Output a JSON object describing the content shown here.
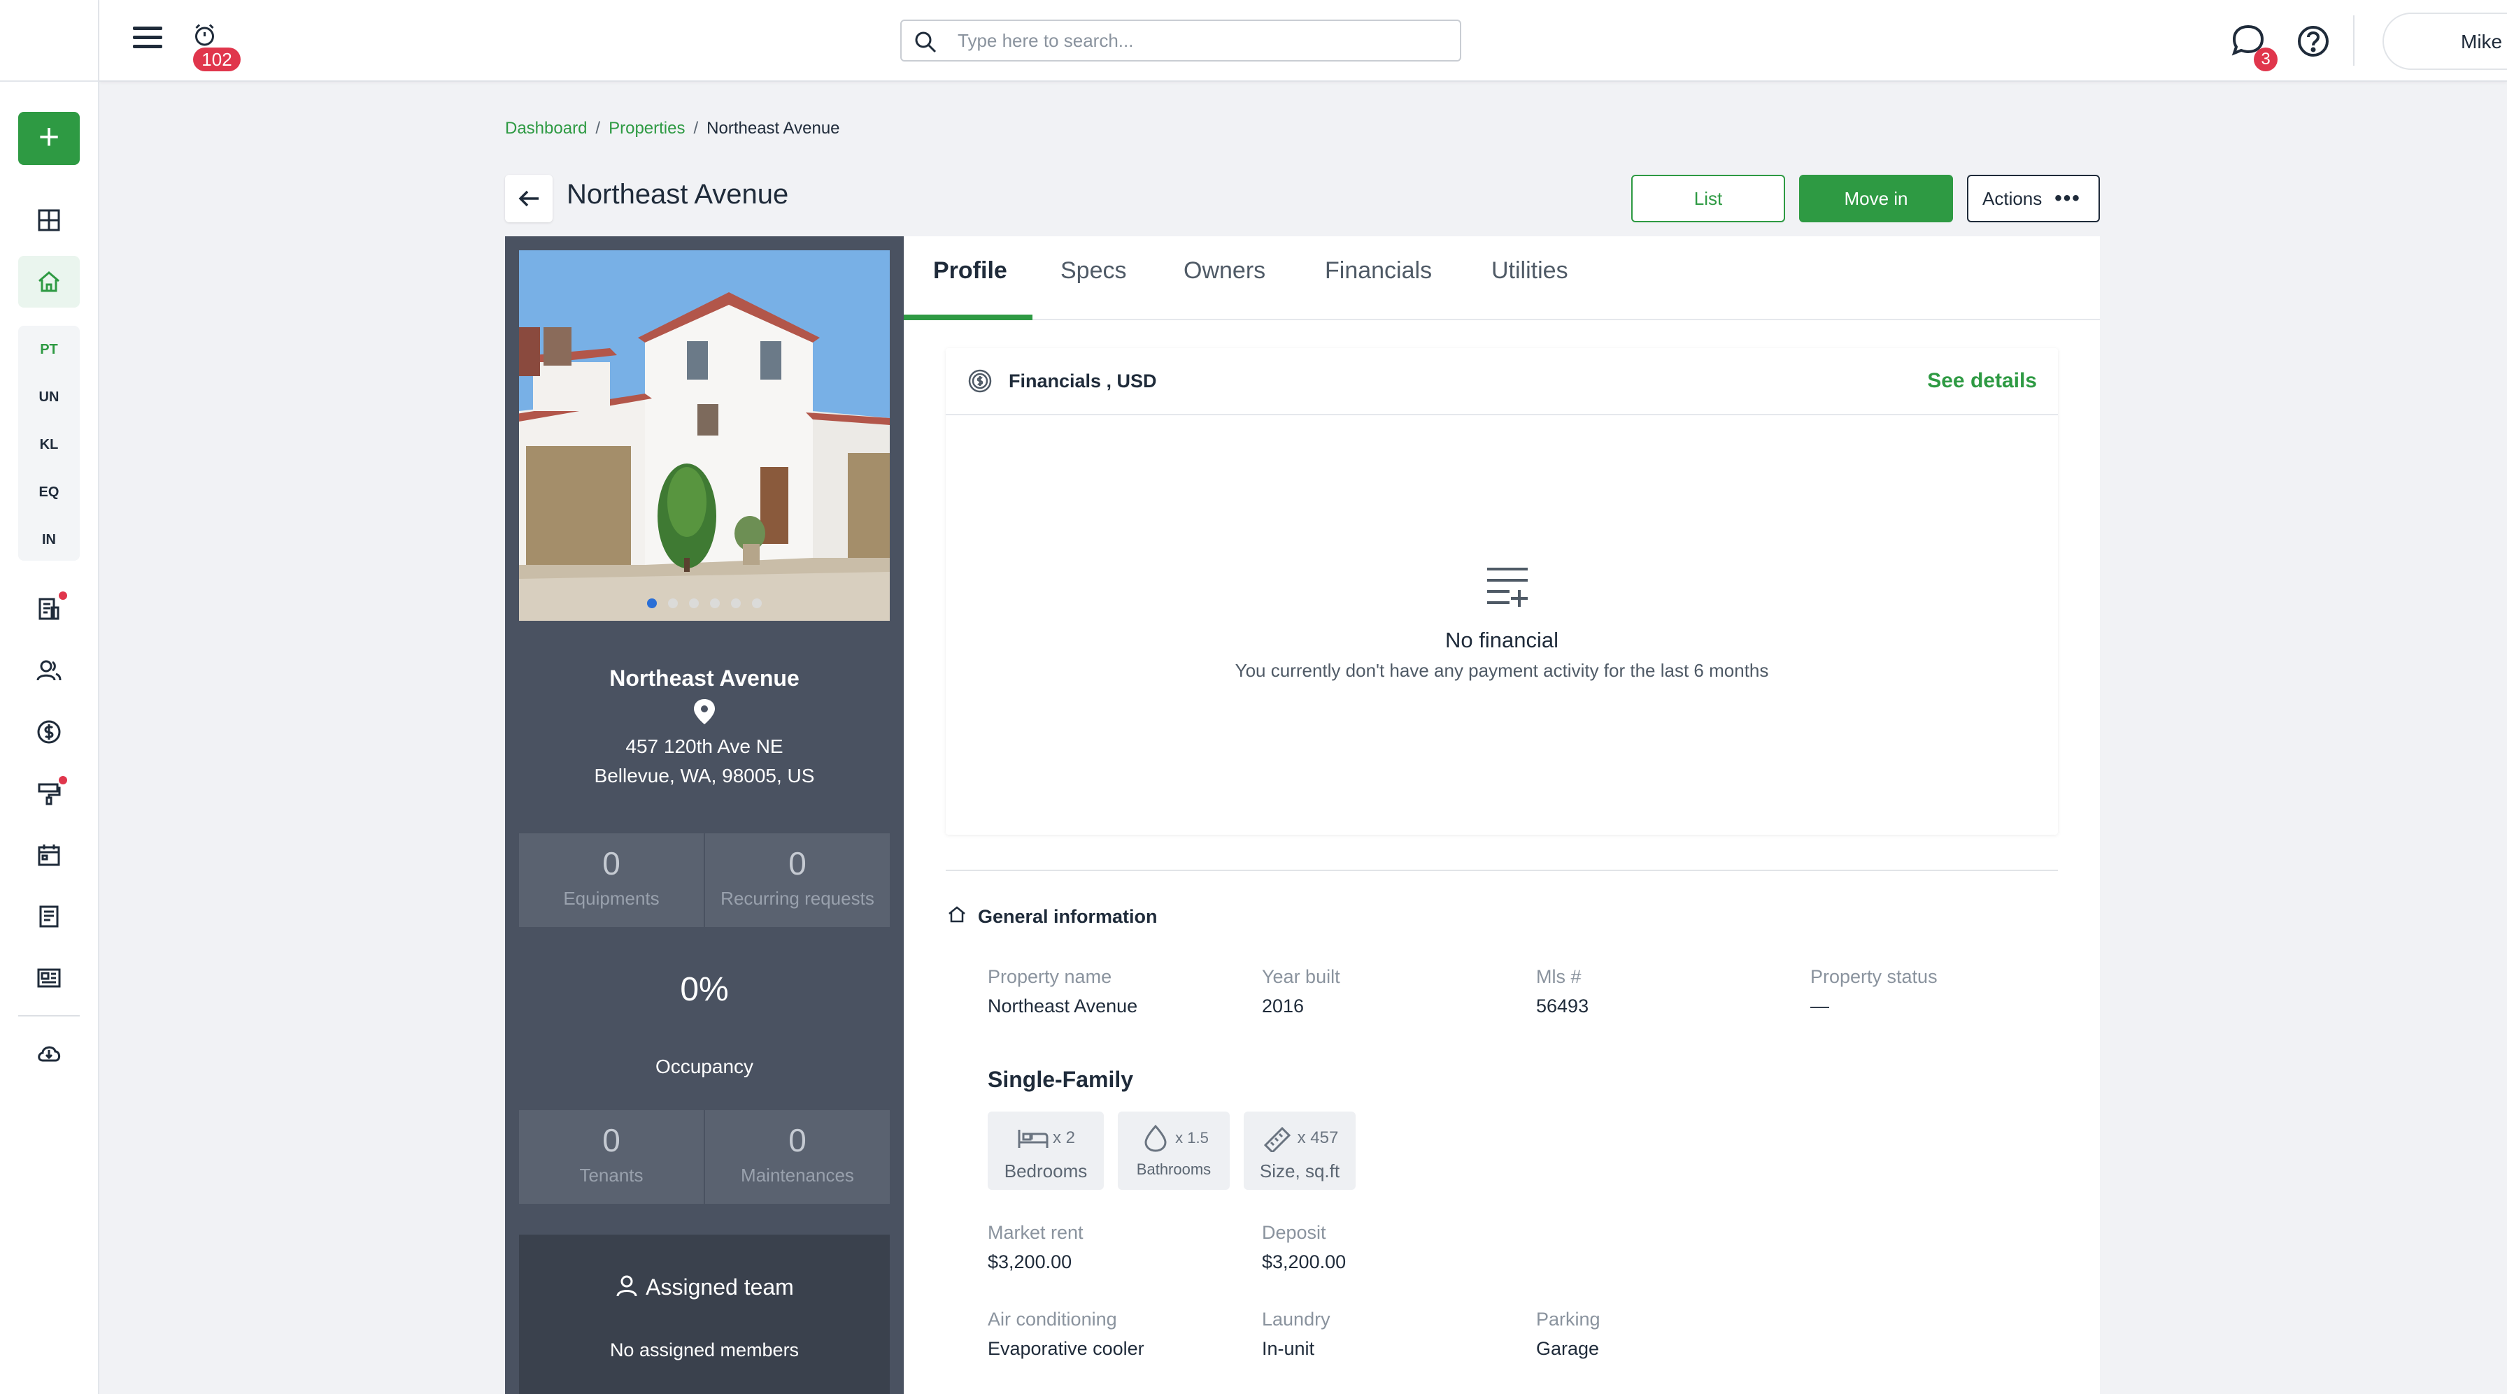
{
  "topbar": {
    "alarm_badge": "102",
    "search_placeholder": "Type here to search...",
    "chat_badge": "3",
    "user_name": "Mike"
  },
  "sidebar": {
    "add_label": "+",
    "sub_items": [
      "PT",
      "UN",
      "KL",
      "EQ",
      "IN"
    ]
  },
  "breadcrumb": {
    "items": [
      "Dashboard",
      "Properties"
    ],
    "current": "Northeast Avenue",
    "separator": "/"
  },
  "header": {
    "title": "Northeast Avenue",
    "list_label": "List",
    "move_in_label": "Move in",
    "actions_label": "Actions",
    "actions_dots": "•••"
  },
  "property": {
    "name": "Northeast Avenue",
    "address_line1": "457 120th Ave NE",
    "address_line2": "Bellevue, WA, 98005, US",
    "photo_count": 6,
    "photo_index": 0,
    "equipments": "0",
    "equipments_label": "Equipments",
    "recurring": "0",
    "recurring_label": "Recurring requests",
    "occupancy": "0%",
    "occupancy_label": "Occupancy",
    "tenants": "0",
    "tenants_label": "Tenants",
    "maintenances": "0",
    "maintenances_label": "Maintenances",
    "team_title": "Assigned team",
    "team_empty": "No assigned members"
  },
  "tabs": [
    "Profile",
    "Specs",
    "Owners",
    "Financials",
    "Utilities"
  ],
  "financials": {
    "title": "Financials , USD",
    "link": "See details",
    "empty_title": "No financial",
    "empty_sub": "You currently don't have any payment activity for the last 6 months"
  },
  "general": {
    "title": "General information",
    "property_name_label": "Property name",
    "property_name": "Northeast Avenue",
    "year_built_label": "Year built",
    "year_built": "2016",
    "mls_label": "Mls #",
    "mls": "56493",
    "status_label": "Property status",
    "status": "—",
    "type": "Single-Family",
    "bedrooms_count": "x 2",
    "bedrooms_label": "Bedrooms",
    "bathrooms_count": "x 1.5",
    "bathrooms_label": "Bathrooms",
    "size_count": "x 457",
    "size_label": "Size, sq.ft",
    "market_rent_label": "Market rent",
    "market_rent": "$3,200.00",
    "deposit_label": "Deposit",
    "deposit": "$3,200.00",
    "ac_label": "Air conditioning",
    "ac": "Evaporative cooler",
    "laundry_label": "Laundry",
    "laundry": "In-unit",
    "parking_label": "Parking",
    "parking": "Garage"
  },
  "colors": {
    "accent": "#2e9a43",
    "badge": "#e0364c",
    "panel": "#4a5261"
  }
}
